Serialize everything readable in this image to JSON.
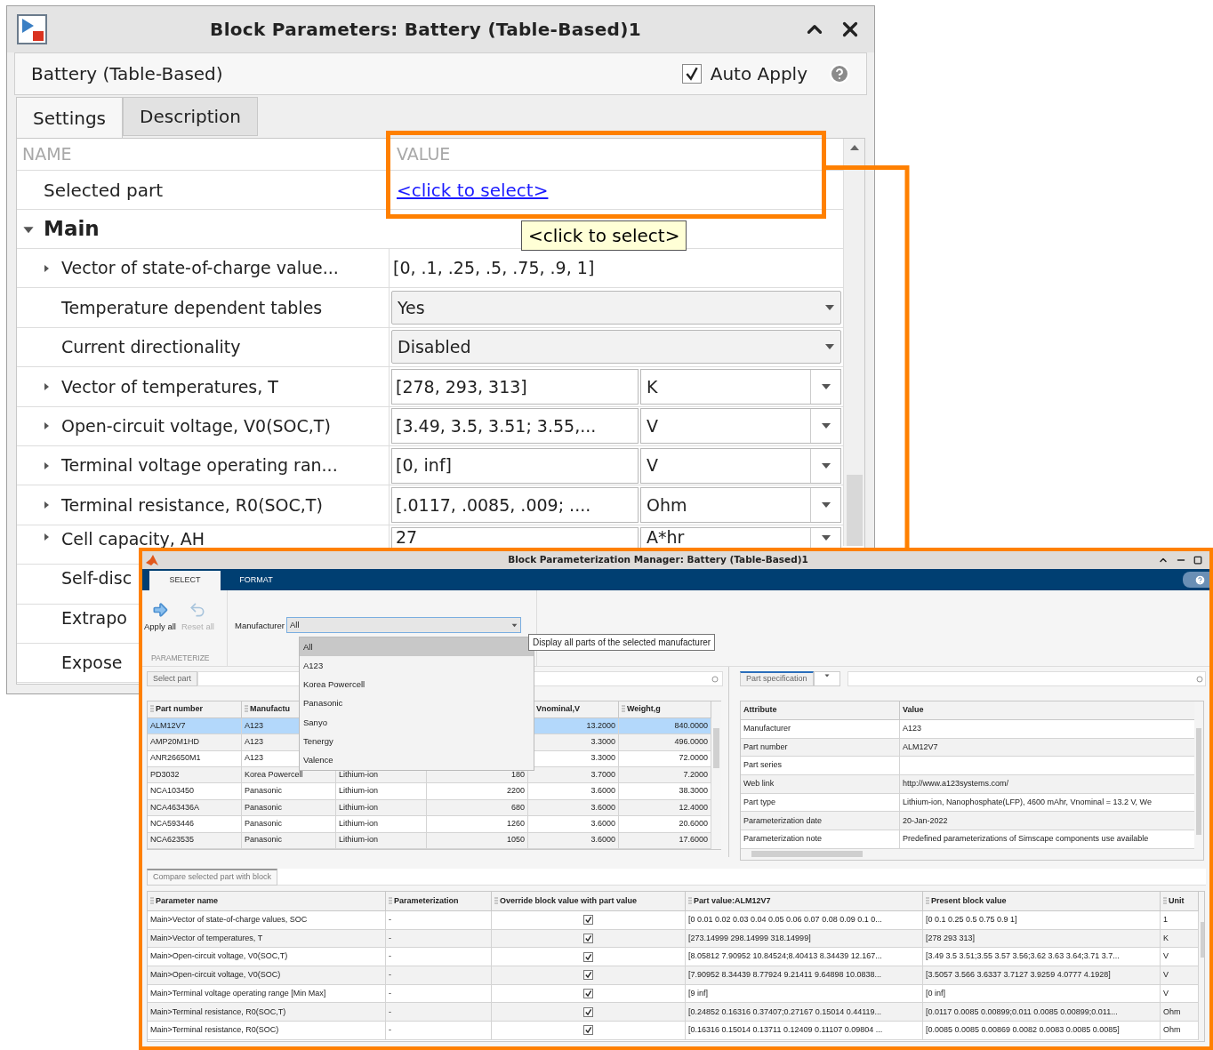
{
  "window": {
    "title": "Block Parameters: Battery (Table-Based)1"
  },
  "block_name": "Battery (Table-Based)",
  "auto_apply": {
    "label": "Auto Apply",
    "checked": true
  },
  "tabs": [
    {
      "label": "Settings",
      "selected": true
    },
    {
      "label": "Description",
      "selected": false
    }
  ],
  "table": {
    "columns": [
      "NAME",
      "VALUE"
    ],
    "selected_part": {
      "label": "Selected part",
      "link": "<click to select>"
    },
    "tooltip": "<click to select>",
    "group": {
      "label": "Main",
      "expanded": true,
      "rows": [
        {
          "kind": "text",
          "label": "Vector of state-of-charge value...",
          "expandable": true,
          "value": "[0, .1, .25, .5, .75, .9, 1]"
        },
        {
          "kind": "dropdown",
          "label": "Temperature dependent tables",
          "expandable": false,
          "value": "Yes"
        },
        {
          "kind": "dropdown",
          "label": "Current directionality",
          "expandable": false,
          "value": "Disabled"
        },
        {
          "kind": "unit",
          "label": "Vector of temperatures, T",
          "expandable": true,
          "value": "[278, 293, 313]",
          "unit": "K"
        },
        {
          "kind": "unit",
          "label": "Open-circuit voltage, V0(SOC,T)",
          "expandable": true,
          "value": "[3.49, 3.5, 3.51; 3.55,...",
          "unit": "V"
        },
        {
          "kind": "unit",
          "label": "Terminal voltage operating ran...",
          "expandable": true,
          "value": "[0, inf]",
          "unit": "V"
        },
        {
          "kind": "unit",
          "label": "Terminal resistance, R0(SOC,T)",
          "expandable": true,
          "value": "[.0117, .0085, .009; ....",
          "unit": "Ohm"
        },
        {
          "kind": "unit",
          "label": "Cell capacity, AH",
          "expandable": true,
          "value": "27",
          "unit": "A*hr"
        },
        {
          "kind": "covered",
          "label": "Self-disc",
          "expandable": false
        },
        {
          "kind": "covered",
          "label": "Extrapo",
          "expandable": false
        },
        {
          "kind": "covered",
          "label": "Expose",
          "expandable": false
        }
      ]
    }
  },
  "manager": {
    "title": "Block Parameterization Manager: Battery (Table-Based)1",
    "ribbon_tabs": [
      {
        "label": "SELECT",
        "selected": true
      },
      {
        "label": "FORMAT",
        "selected": false
      }
    ],
    "actions": [
      {
        "label": "Apply all",
        "disabled": false
      },
      {
        "label": "Reset all",
        "disabled": true
      }
    ],
    "section_label": "PARAMETERIZE",
    "manufacturer": {
      "label": "Manufacturer",
      "value": "All",
      "tooltip": "Display all parts of the selected manufacturer",
      "options": [
        {
          "label": "All",
          "selected": true
        },
        {
          "label": "A123",
          "selected": false
        },
        {
          "label": "Korea Powercell",
          "selected": false
        },
        {
          "label": "Panasonic",
          "selected": false
        },
        {
          "label": "Sanyo",
          "selected": false
        },
        {
          "label": "Tenergy",
          "selected": false
        },
        {
          "label": "Valence",
          "selected": false
        }
      ]
    },
    "parts_panel": {
      "tab": "Select part",
      "columns": [
        {
          "label": "Part number",
          "grip": true
        },
        {
          "label": "Manufactu",
          "grip": true
        },
        null,
        null,
        {
          "label": "Vnominal,V",
          "grip": false
        },
        {
          "label": "Weight,g",
          "grip": true
        }
      ],
      "rows": [
        {
          "selected": true,
          "cells": [
            "ALM12V7",
            "A123",
            null,
            null,
            "13.2000",
            "840.0000"
          ]
        },
        {
          "selected": false,
          "cells": [
            "AMP20M1HD",
            "A123",
            null,
            null,
            "3.3000",
            "496.0000"
          ]
        },
        {
          "selected": false,
          "cells": [
            "ANR26650M1",
            "A123",
            null,
            null,
            "3.3000",
            "72.0000"
          ]
        },
        {
          "selected": false,
          "cells": [
            "PD3032",
            "Korea Powercell",
            "Lithium-ion",
            "180",
            "3.7000",
            "7.2000"
          ]
        },
        {
          "selected": false,
          "cells": [
            "NCA103450",
            "Panasonic",
            "Lithium-ion",
            "2200",
            "3.6000",
            "38.3000"
          ]
        },
        {
          "selected": false,
          "cells": [
            "NCA463436A",
            "Panasonic",
            "Lithium-ion",
            "680",
            "3.6000",
            "12.4000"
          ]
        },
        {
          "selected": false,
          "cells": [
            "NCA593446",
            "Panasonic",
            "Lithium-ion",
            "1260",
            "3.6000",
            "20.6000"
          ]
        },
        {
          "selected": false,
          "cells": [
            "NCA623535",
            "Panasonic",
            "Lithium-ion",
            "1050",
            "3.6000",
            "17.6000"
          ]
        }
      ]
    },
    "spec_panel": {
      "tab": "Part specification",
      "columns": [
        "Attribute",
        "Value"
      ],
      "rows": [
        {
          "attribute": "Manufacturer",
          "value": "A123"
        },
        {
          "attribute": "Part number",
          "value": "ALM12V7"
        },
        {
          "attribute": "Part series"
        },
        {
          "attribute": "Web link",
          "value": "http://www.a123systems.com/"
        },
        {
          "attribute": "Part type",
          "value": "Lithium-ion, Nanophosphate(LFP), 4600 mAhr, Vnominal = 13.2 V, We"
        },
        {
          "attribute": "Parameterization date",
          "value": "20-Jan-2022"
        },
        {
          "attribute": "Parameterization note",
          "value": "Predefined parameterizations of Simscape components use available"
        }
      ]
    },
    "compare_panel": {
      "tab": "Compare selected part with block",
      "columns": [
        "Parameter name",
        "Parameterization",
        "Override block value with part value",
        "Part value:ALM12V7",
        "Present block value",
        "Unit"
      ],
      "rows": [
        {
          "parameter": "Main>Vector of state-of-charge values, SOC",
          "parameterization": "-",
          "override": true,
          "part_value": "[0 0.01 0.02 0.03 0.04 0.05 0.06 0.07 0.08 0.09 0.1 0...",
          "present_value": "[0 0.1 0.25 0.5 0.75 0.9 1]",
          "unit": "1"
        },
        {
          "parameter": "Main>Vector of temperatures, T",
          "parameterization": "-",
          "override": true,
          "part_value": "[273.14999 298.14999 318.14999]",
          "present_value": "[278 293 313]",
          "unit": "K"
        },
        {
          "parameter": "Main>Open-circuit voltage, V0(SOC,T)",
          "parameterization": "-",
          "override": true,
          "part_value": "[8.05812 7.90952 10.84524;8.40413 8.34439 12.167...",
          "present_value": "[3.49 3.5 3.51;3.55 3.57 3.56;3.62 3.63 3.64;3.71 3.7...",
          "unit": "V"
        },
        {
          "parameter": "Main>Open-circuit voltage, V0(SOC)",
          "parameterization": "-",
          "override": true,
          "part_value": "[7.90952 8.34439 8.77924 9.21411 9.64898 10.0838...",
          "present_value": "[3.5057 3.566 3.6337 3.7127 3.9259 4.0777 4.1928]",
          "unit": "V"
        },
        {
          "parameter": "Main>Terminal voltage operating range [Min Max]",
          "parameterization": "-",
          "override": true,
          "part_value": "[9 inf]",
          "present_value": "[0 inf]",
          "unit": "V"
        },
        {
          "parameter": "Main>Terminal resistance, R0(SOC,T)",
          "parameterization": "-",
          "override": true,
          "part_value": "[0.24852 0.16316 0.37407;0.27167 0.15014 0.44119...",
          "present_value": "[0.0117 0.0085 0.00899;0.011 0.0085 0.00899;0.011...",
          "unit": "Ohm"
        },
        {
          "parameter": "Main>Terminal resistance, R0(SOC)",
          "parameterization": "-",
          "override": true,
          "part_value": "[0.16316 0.15014 0.13711 0.12409 0.11107 0.09804 ...",
          "present_value": "[0.0085 0.0085 0.00869 0.0082 0.0083 0.0085 0.0085]",
          "unit": "Ohm"
        }
      ]
    }
  }
}
